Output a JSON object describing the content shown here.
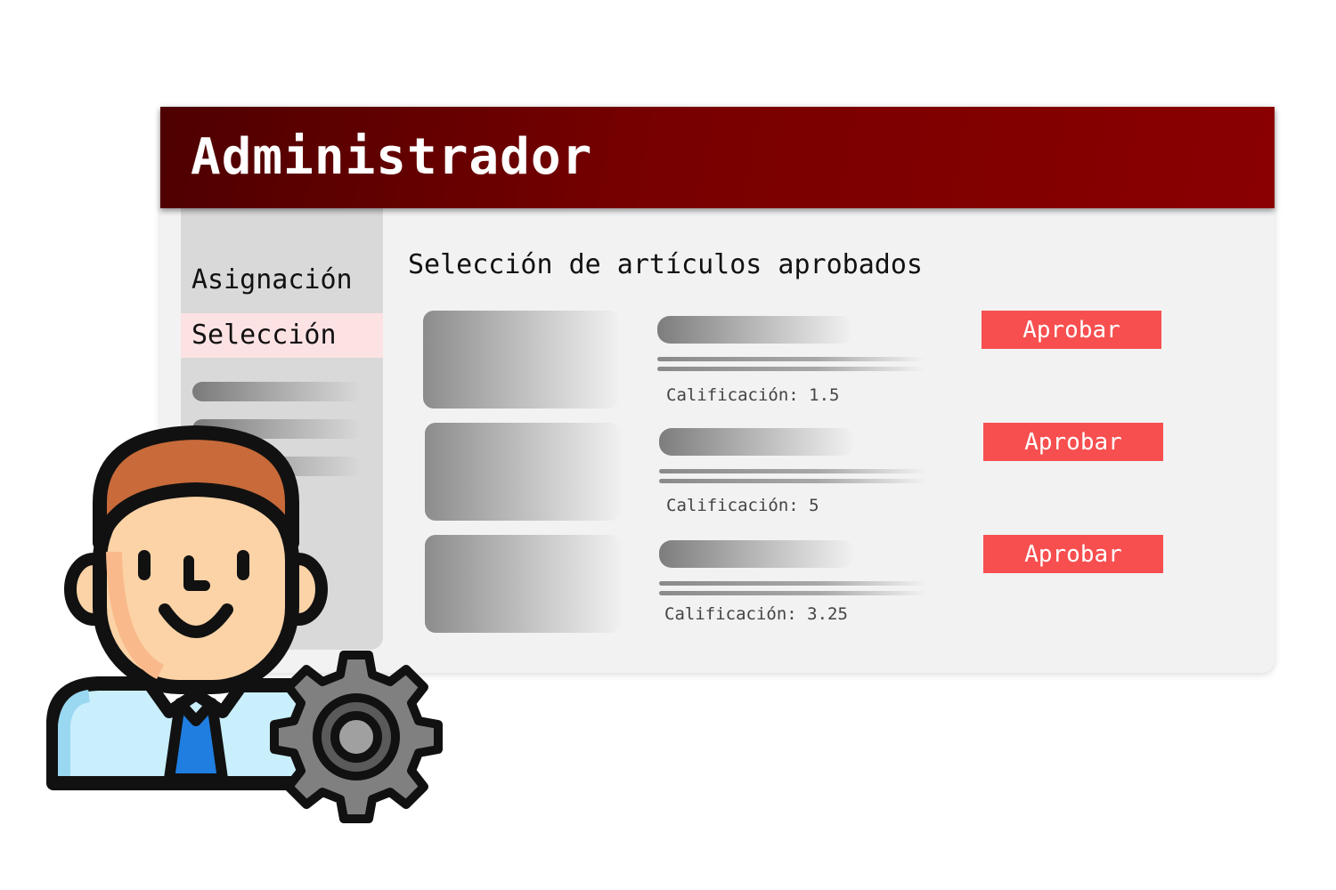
{
  "header": {
    "title": "Administrador"
  },
  "sidebar": {
    "items": [
      {
        "label": "Asignación",
        "active": false
      },
      {
        "label": "Selección",
        "active": true
      }
    ]
  },
  "main": {
    "title": "Selección de artículos aprobados",
    "articles": [
      {
        "rating": "Calificación: 1.5",
        "button": "Aprobar"
      },
      {
        "rating": "Calificación: 5",
        "button": "Aprobar"
      },
      {
        "rating": "Calificación: 3.25",
        "button": "Aprobar"
      }
    ]
  },
  "colors": {
    "header_dark": "#4e0000",
    "header_light": "#8a0000",
    "approve_button": "#f74f4f",
    "active_nav": "#fde2e4"
  },
  "icons": [
    "admin-user-icon",
    "gear-icon"
  ]
}
